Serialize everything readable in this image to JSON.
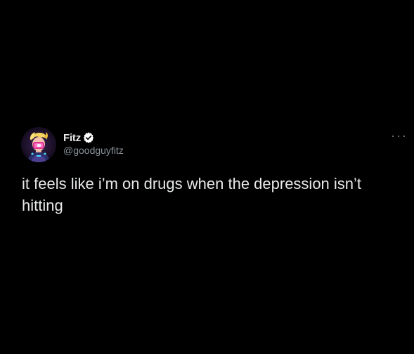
{
  "tweet": {
    "author": {
      "display_name": "Fitz",
      "handle": "@goodguyfitz",
      "verified": true,
      "avatar_icon": "cartoon-avatar-icon"
    },
    "text": "it feels like i’m on drugs when the depression isn’t hitting",
    "more_icon": "more-options-icon"
  },
  "colors": {
    "background": "#000000",
    "text_primary": "#e7e9ea",
    "text_secondary": "#8b9199",
    "verified_badge": "#ffffff"
  }
}
